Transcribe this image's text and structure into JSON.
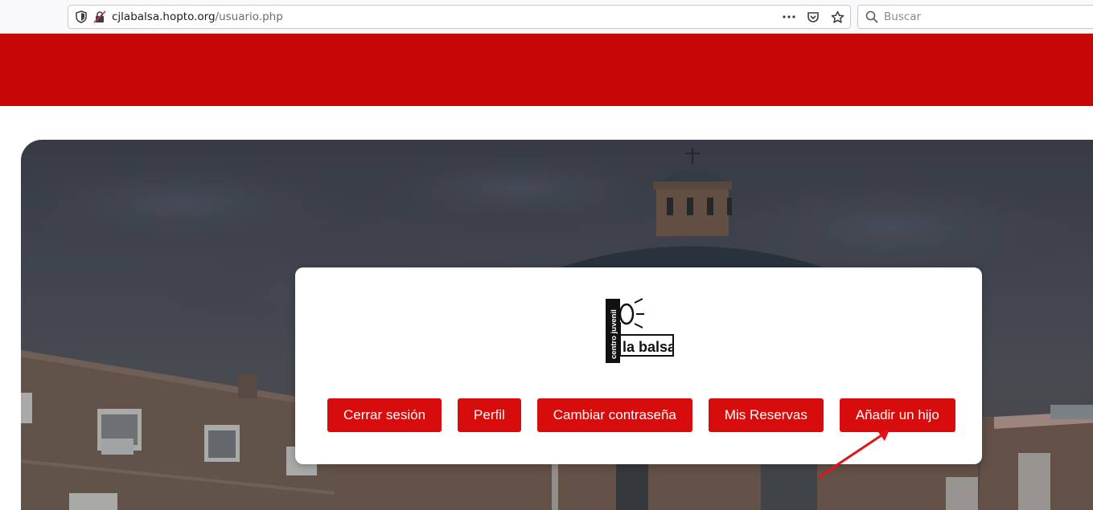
{
  "browser": {
    "url_host": "cjlabalsa.hopto.org",
    "url_path": "/usuario.php",
    "search_placeholder": "Buscar",
    "icons": [
      "shield-icon",
      "insecure-lock-icon",
      "more-icon",
      "pocket-icon",
      "star-icon",
      "search-icon"
    ]
  },
  "header": {
    "band_color": "#c70606"
  },
  "card": {
    "logo": {
      "line1": "centro juvenil",
      "line2": "la balsa"
    },
    "buttons": [
      {
        "label": "Cerrar sesión"
      },
      {
        "label": "Perfil"
      },
      {
        "label": "Cambiar contraseña"
      },
      {
        "label": "Mis Reservas"
      },
      {
        "label": "Añadir un hijo"
      }
    ],
    "button_color": "#d70d0d"
  }
}
